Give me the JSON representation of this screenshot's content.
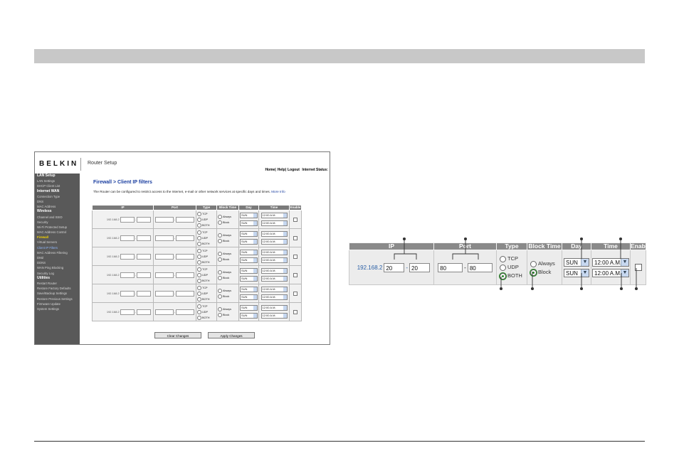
{
  "header": {
    "brand": "BELKIN",
    "title": "Router Setup",
    "links": [
      "Home",
      "Help",
      "Logout",
      "Internet Status:"
    ]
  },
  "sidebar": [
    {
      "label": "LAN Setup",
      "kind": "head"
    },
    {
      "label": "LAN Settings",
      "kind": "item"
    },
    {
      "label": "DHCP Client List",
      "kind": "item"
    },
    {
      "label": "Internet WAN",
      "kind": "head"
    },
    {
      "label": "Connection Type",
      "kind": "item"
    },
    {
      "label": "DNS",
      "kind": "item"
    },
    {
      "label": "MAC Address",
      "kind": "item"
    },
    {
      "label": "Wireless",
      "kind": "head"
    },
    {
      "label": "Channel and SSID",
      "kind": "item"
    },
    {
      "label": "Security",
      "kind": "item"
    },
    {
      "label": "Wi-Fi Protected Setup",
      "kind": "item"
    },
    {
      "label": "MAC Address Control",
      "kind": "item"
    },
    {
      "label": "Firewall",
      "kind": "active"
    },
    {
      "label": "Virtual Servers",
      "kind": "item"
    },
    {
      "label": "Client IP Filters",
      "kind": "sel"
    },
    {
      "label": "MAC Address Filtering",
      "kind": "item"
    },
    {
      "label": "DMZ",
      "kind": "item"
    },
    {
      "label": "DDNS",
      "kind": "item"
    },
    {
      "label": "WAN Ping Blocking",
      "kind": "item"
    },
    {
      "label": "Security Log",
      "kind": "item"
    },
    {
      "label": "Utilities",
      "kind": "head"
    },
    {
      "label": "Restart Router",
      "kind": "item"
    },
    {
      "label": "Restore Factory Defaults",
      "kind": "item"
    },
    {
      "label": "Save/Backup Settings",
      "kind": "item"
    },
    {
      "label": "Restore Previous Settings",
      "kind": "item"
    },
    {
      "label": "Firmware Update",
      "kind": "item"
    },
    {
      "label": "System Settings",
      "kind": "item"
    }
  ],
  "page": {
    "title": "Firewall > Client IP filters",
    "description": "The Router can be configured to restrict access to the Internet, e-mail or other network services at specific days and times.",
    "more_info": "More Info"
  },
  "table": {
    "columns": [
      "IP",
      "Port",
      "Type",
      "Block Time",
      "Day",
      "Time",
      "Enable"
    ],
    "ip_prefix": "192.168.2",
    "type_options": [
      "TCP",
      "UDP",
      "BOTH"
    ],
    "block_options": [
      "Always",
      "Block"
    ],
    "day_default": "SUN",
    "time_default": "12:00 A.M.",
    "row_count": 6
  },
  "buttons": {
    "clear": "Clear Changes",
    "apply": "Apply Changes"
  },
  "zoom": {
    "columns": [
      "IP",
      "Port",
      "Type",
      "Block Time",
      "Day",
      "Time",
      "Enable"
    ],
    "ip_prefix": "192.168.2",
    "ip_start": "20",
    "ip_end": "20",
    "port_start": "80",
    "port_end": "80",
    "type_options": [
      "TCP",
      "UDP",
      "BOTH"
    ],
    "type_selected": "BOTH",
    "block_options": [
      "Always",
      "Block"
    ],
    "block_selected": "Block",
    "day_from": "SUN",
    "day_to": "SUN",
    "time_from": "12:00 A.M.",
    "time_to": "12:00 A.M.",
    "enabled": false
  },
  "colors": {
    "accent_link": "#1a3ea0",
    "sidebar_bg": "#595959",
    "active_item": "#f5d400",
    "selected_radio": "#2a8a2a"
  }
}
